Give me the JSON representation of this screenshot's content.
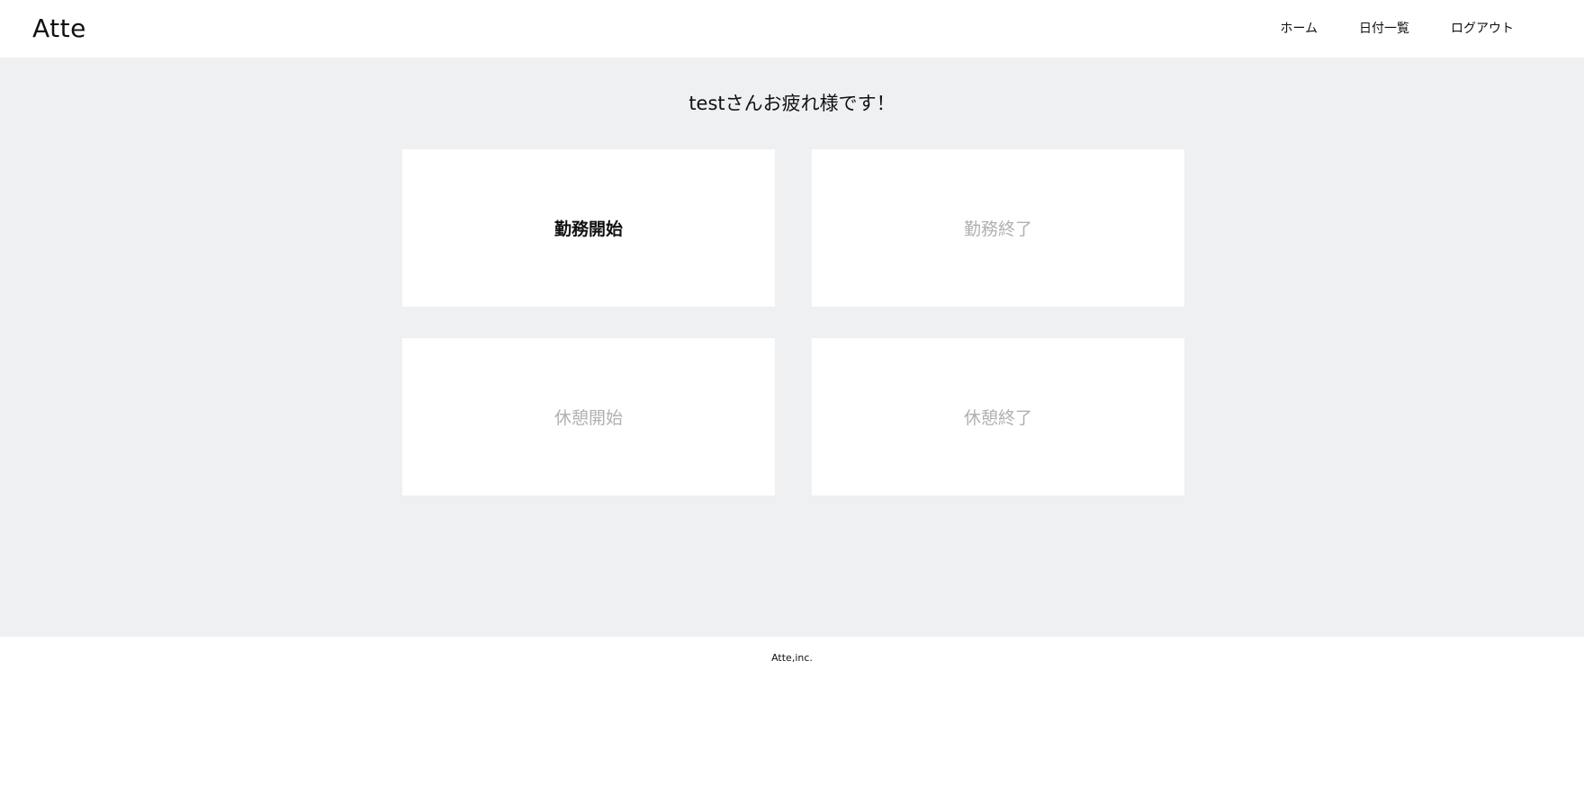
{
  "header": {
    "logo": "Atte",
    "nav": [
      {
        "label": "ホーム"
      },
      {
        "label": "日付一覧"
      },
      {
        "label": "ログアウト"
      }
    ]
  },
  "main": {
    "greeting": "testさんお疲れ様です！",
    "buttons": [
      {
        "label": "勤務開始",
        "state": "enabled"
      },
      {
        "label": "勤務終了",
        "state": "disabled"
      },
      {
        "label": "休憩開始",
        "state": "disabled"
      },
      {
        "label": "休憩終了",
        "state": "disabled"
      }
    ]
  },
  "footer": {
    "text": "Atte,inc."
  },
  "colors": {
    "background": "#eff0f2",
    "card": "#ffffff",
    "text": "#111111",
    "disabled_text": "#b0b0b0"
  }
}
